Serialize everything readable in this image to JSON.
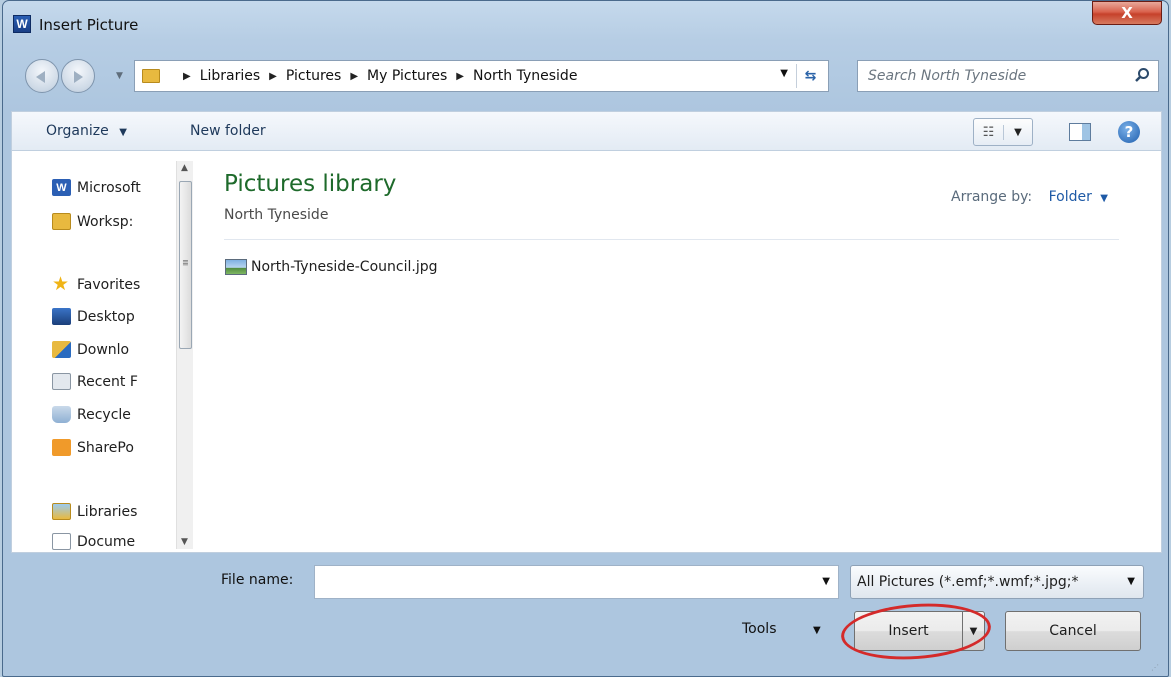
{
  "window": {
    "title": "Insert Picture",
    "app_icon_letter": "W",
    "close_symbol": "X"
  },
  "address": {
    "crumbs": [
      "Libraries",
      "Pictures",
      "My Pictures",
      "North Tyneside"
    ],
    "refresh_symbol": "⇆"
  },
  "search": {
    "placeholder": "Search North Tyneside"
  },
  "toolbar": {
    "organize_label": "Organize",
    "new_folder_label": "New folder",
    "help_symbol": "?"
  },
  "nav": {
    "items": [
      {
        "label": "Microsoft",
        "icon": "word-icon"
      },
      {
        "label": "Worksp:",
        "icon": "folder-icon"
      },
      {
        "label": "Favorites",
        "icon": "star-icon"
      },
      {
        "label": "Desktop",
        "icon": "desktop-icon"
      },
      {
        "label": "Downlo",
        "icon": "downloads-icon"
      },
      {
        "label": "Recent F",
        "icon": "recent-places-icon"
      },
      {
        "label": "Recycle",
        "icon": "recycle-bin-icon"
      },
      {
        "label": "SharePo",
        "icon": "sharepoint-icon"
      },
      {
        "label": "Libraries",
        "icon": "libraries-icon"
      },
      {
        "label": "Docume",
        "icon": "documents-icon"
      }
    ]
  },
  "main": {
    "library_title": "Pictures library",
    "library_subtitle": "North Tyneside",
    "arrange_label": "Arrange by:",
    "arrange_value": "Folder",
    "files": [
      {
        "name": "North-Tyneside-Council.jpg",
        "icon": "image-file-icon"
      }
    ]
  },
  "footer": {
    "file_name_label": "File name:",
    "file_name_value": "",
    "file_type_value": "All Pictures (*.emf;*.wmf;*.jpg;*",
    "tools_label": "Tools",
    "insert_label": "Insert",
    "cancel_label": "Cancel"
  },
  "colors": {
    "library_title": "#1e6a2b",
    "highlight_ring": "#d42a2a",
    "link_blue": "#1e5aa6"
  }
}
